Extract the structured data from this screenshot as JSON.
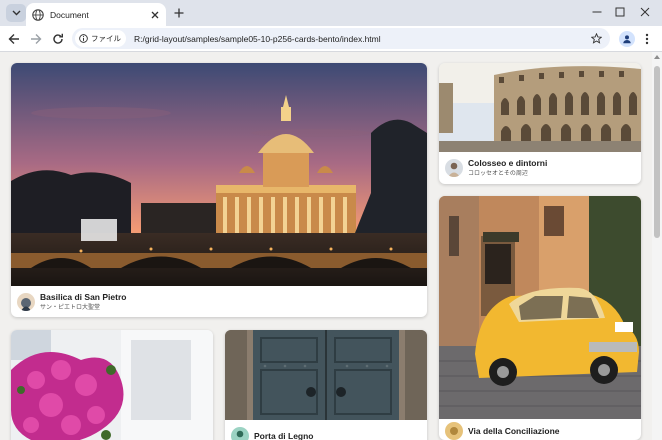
{
  "browser": {
    "tab_title": "Document",
    "address_chip": "ファイル",
    "url": "R:/grid-layout/samples/sample05-10-p256-cards-bento/index.html"
  },
  "cards": [
    {
      "title": "Basilica di San Pietro",
      "subtitle": "サン・ピエトロ大聖堂"
    },
    {
      "title": "Colosseo e dintorni",
      "subtitle": "コロッセオとその周辺"
    },
    {
      "title": "Via della Conciliazione",
      "subtitle": ""
    },
    {
      "title": "Porta di Legno",
      "subtitle": ""
    },
    {
      "title": "",
      "subtitle": ""
    }
  ],
  "icons": {
    "tab_menu": "chevron-down-icon",
    "favicon": "globe-icon",
    "tab_close": "close-icon",
    "new_tab": "plus-icon",
    "back": "arrow-left-icon",
    "forward": "arrow-right-icon",
    "reload": "reload-icon",
    "info": "info-icon",
    "bookmark": "star-icon",
    "profile": "person-icon",
    "menu": "kebab-icon"
  }
}
